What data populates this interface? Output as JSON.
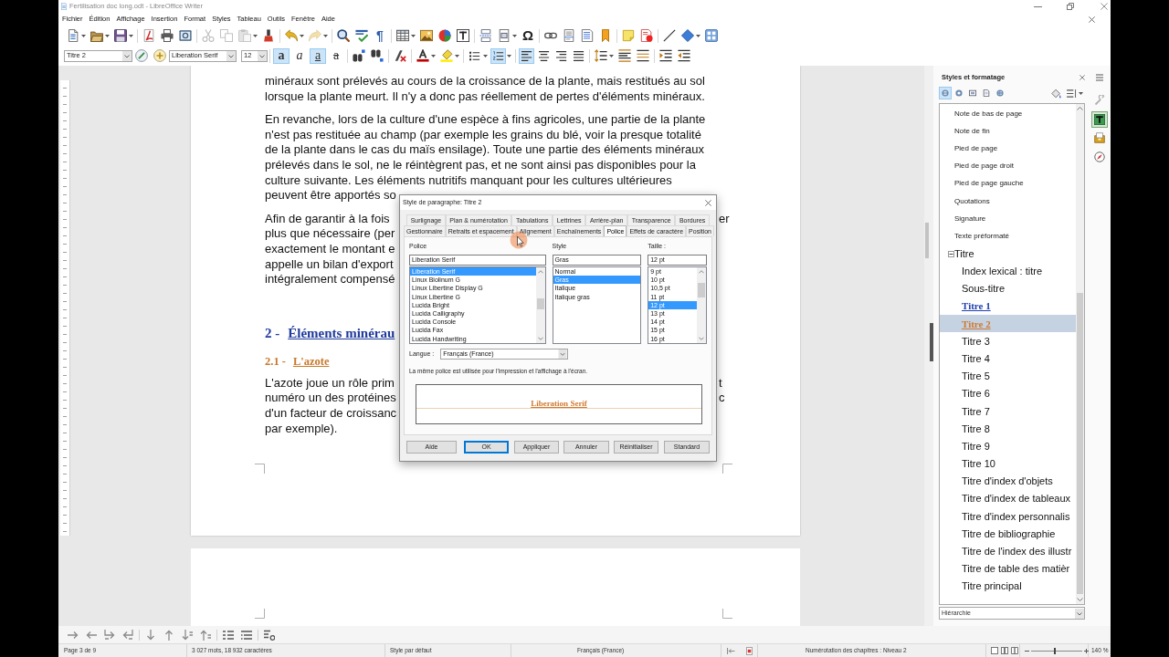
{
  "window": {
    "title": "Fertilisation doc long.odt - LibreOffice Writer"
  },
  "menu": [
    "Fichier",
    "Édition",
    "Affichage",
    "Insertion",
    "Format",
    "Styles",
    "Tableau",
    "Outils",
    "Fenêtre",
    "Aide"
  ],
  "standard_toolbar": {
    "cut_disabled": true,
    "copy_disabled": true,
    "paste_disabled": true,
    "redo_disabled": true,
    "formatting_marks_glyph": "¶",
    "special_character_glyph": "Ω"
  },
  "formatting_toolbar": {
    "paragraph_style": "Titre 2",
    "font_name": "Liberation Serif",
    "font_size": "12",
    "character_toggles": [
      {
        "kind": "bold",
        "glyph": "a",
        "active": true
      },
      {
        "kind": "italic",
        "glyph": "a",
        "active": false
      },
      {
        "kind": "underline",
        "glyph": "a",
        "active": true
      },
      {
        "kind": "strikethrough",
        "glyph": "a",
        "active": false
      }
    ],
    "bullets_active": false,
    "numbering_active": true,
    "alignments": [
      {
        "kind": "left",
        "selected": true
      },
      {
        "kind": "center",
        "selected": false
      },
      {
        "kind": "right",
        "selected": false
      },
      {
        "kind": "justify",
        "selected": false
      }
    ]
  },
  "document": {
    "blocks": [
      {
        "kind": "paragraph",
        "lines": [
          "minéraux sont prélevés au cours de la croissance de la plante, mais restitués au sol",
          "lorsque la plante meurt. Il n'y a donc pas réellement de pertes d'éléments minéraux."
        ]
      },
      {
        "kind": "paragraph",
        "lines": [
          "En revanche, lors de la culture d'une espèce à fins agricoles, une partie de la plante",
          "n'est pas restituée au champ (par exemple les grains du blé, voir la presque totalité",
          "de la plante dans le cas du maïs ensilage). Toute une partie des éléments minéraux",
          "prélevés dans le sol, ne le réintègrent pas, et ne sont ainsi pas disponibles pour la",
          "culture suivante. Les éléments nutritifs manquant pour les cultures ultérieures"
        ],
        "covered_lines": [
          "peuvent être apportés so"
        ]
      },
      {
        "kind": "paragraph",
        "lines": [
          "Afin de garantir à la fois",
          "plus que nécessaire (per",
          "exactement le montant e",
          "appelle un bilan d'export",
          "intégralement compensé"
        ],
        "right_fragments": [
          "er"
        ]
      },
      {
        "kind": "heading-1",
        "number": "2 -",
        "text": "Éléments minérau"
      },
      {
        "kind": "heading-2",
        "number": "2.1 -",
        "text": "L'azote"
      },
      {
        "kind": "paragraph",
        "lines": [
          "L'azote joue un rôle prim",
          "numéro un des protéines",
          "d'un facteur de croissanc",
          "par exemple)."
        ],
        "right_fragments": [
          "t",
          "c"
        ]
      }
    ]
  },
  "dialog": {
    "title": "Style de paragraphe: Titre 2",
    "tab_rows": [
      [
        {
          "label": "Surlignage",
          "selected": false
        },
        {
          "label": "Plan & numérotation",
          "selected": false
        },
        {
          "label": "Tabulations",
          "selected": false
        },
        {
          "label": "Lettrines",
          "selected": false
        },
        {
          "label": "Arrière-plan",
          "selected": false
        },
        {
          "label": "Transparence",
          "selected": false
        },
        {
          "label": "Bordures",
          "selected": false
        }
      ],
      [
        {
          "label": "Gestionnaire",
          "selected": false
        },
        {
          "label": "Retraits et espacement",
          "selected": false
        },
        {
          "label": "Alignement",
          "selected": false
        },
        {
          "label": "Enchaînements",
          "selected": false
        },
        {
          "label": "Police",
          "selected": true
        },
        {
          "label": "Effets de caractère",
          "selected": false
        },
        {
          "label": "Position",
          "selected": false
        }
      ]
    ],
    "font_family": {
      "label": "Police",
      "value": "Liberation Serif",
      "options": [
        {
          "label": "Liberation Serif",
          "selected": true
        },
        {
          "label": "Linux Biolinum G",
          "selected": false
        },
        {
          "label": "Linux Libertine Display G",
          "selected": false
        },
        {
          "label": "Linux Libertine G",
          "selected": false
        },
        {
          "label": "Lucida Bright",
          "selected": false
        },
        {
          "label": "Lucida Calligraphy",
          "selected": false
        },
        {
          "label": "Lucida Console",
          "selected": false
        },
        {
          "label": "Lucida Fax",
          "selected": false
        },
        {
          "label": "Lucida Handwriting",
          "selected": false
        }
      ]
    },
    "font_style": {
      "label": "Style",
      "value": "Gras",
      "options": [
        {
          "label": "Normal",
          "selected": false
        },
        {
          "label": "Gras",
          "selected": true
        },
        {
          "label": "Italique",
          "selected": false
        },
        {
          "label": "Italique gras",
          "selected": false
        }
      ]
    },
    "font_size": {
      "label": "Taille :",
      "value": "12 pt",
      "options": [
        {
          "label": "9 pt",
          "selected": false
        },
        {
          "label": "10 pt",
          "selected": false
        },
        {
          "label": "10,5 pt",
          "selected": false
        },
        {
          "label": "11 pt",
          "selected": false
        },
        {
          "label": "12 pt",
          "selected": true
        },
        {
          "label": "13 pt",
          "selected": false
        },
        {
          "label": "14 pt",
          "selected": false
        },
        {
          "label": "15 pt",
          "selected": false
        },
        {
          "label": "16 pt",
          "selected": false
        }
      ]
    },
    "language": {
      "label": "Langue :",
      "value": "Français (France)"
    },
    "note": "La même police est utilisée pour l'impression et l'affichage à l'écran.",
    "preview": "Liberation Serif",
    "buttons": [
      {
        "label": "Aide",
        "default": false
      },
      {
        "label": "OK",
        "default": true
      },
      {
        "label": "Appliquer",
        "default": false
      },
      {
        "label": "Annuler",
        "default": false
      },
      {
        "label": "Réinitialiser",
        "default": false
      },
      {
        "label": "Standard",
        "default": false
      }
    ]
  },
  "sidebar": {
    "title": "Styles et formatage",
    "style_families": [
      {
        "selected": true
      },
      {
        "selected": false
      },
      {
        "selected": false
      },
      {
        "selected": false
      },
      {
        "selected": false
      }
    ],
    "styles": [
      {
        "label": "Note de bas de page",
        "kind": "small",
        "selected": false
      },
      {
        "label": "Note de fin",
        "kind": "small",
        "selected": false
      },
      {
        "label": "Pied de page",
        "kind": "small",
        "selected": false
      },
      {
        "label": "Pied de page droit",
        "kind": "small",
        "selected": false
      },
      {
        "label": "Pied de page gauche",
        "kind": "small",
        "selected": false
      },
      {
        "label": "Quotations",
        "kind": "small",
        "selected": false
      },
      {
        "label": "Signature",
        "kind": "small",
        "selected": false
      },
      {
        "label": "Texte préformaté",
        "kind": "small",
        "selected": false
      },
      {
        "label": "Titre",
        "kind": "large",
        "selected": false,
        "expanded": true,
        "children": [
          {
            "label": "Index lexical : titre",
            "kind": "large",
            "selected": false
          },
          {
            "label": "Sous-titre",
            "kind": "large",
            "selected": false
          },
          {
            "label": "Titre 1",
            "kind": "heading-1",
            "selected": false
          },
          {
            "label": "Titre 2",
            "kind": "heading-2",
            "selected": true
          },
          {
            "label": "Titre 3",
            "kind": "large",
            "selected": false
          },
          {
            "label": "Titre 4",
            "kind": "large",
            "selected": false
          },
          {
            "label": "Titre 5",
            "kind": "large",
            "selected": false
          },
          {
            "label": "Titre 6",
            "kind": "large",
            "selected": false
          },
          {
            "label": "Titre 7",
            "kind": "large",
            "selected": false
          },
          {
            "label": "Titre 8",
            "kind": "large",
            "selected": false
          },
          {
            "label": "Titre 9",
            "kind": "large",
            "selected": false
          },
          {
            "label": "Titre 10",
            "kind": "large",
            "selected": false
          },
          {
            "label": "Titre d'index d'objets",
            "kind": "large",
            "selected": false
          },
          {
            "label": "Titre d'index de tableaux",
            "kind": "large",
            "selected": false
          },
          {
            "label": "Titre d'index personnalis",
            "kind": "large",
            "selected": false
          },
          {
            "label": "Titre de bibliographie",
            "kind": "large",
            "selected": false
          },
          {
            "label": "Titre de l'index des illustr",
            "kind": "large",
            "selected": false
          },
          {
            "label": "Titre de table des matièr",
            "kind": "large",
            "selected": false
          },
          {
            "label": "Titre principal",
            "kind": "large",
            "selected": false
          }
        ]
      }
    ],
    "filter": "Hiérarchie",
    "deck_tabs": [
      {
        "selected": false
      },
      {
        "selected": true
      },
      {
        "selected": false
      },
      {
        "selected": false
      }
    ]
  },
  "status_bar": {
    "page": "Page 3 de 9",
    "word_count": "3 027 mots, 18 932 caractères",
    "page_style": "Style par défaut",
    "language": "Français (France)",
    "outline_level": "Numérotation des chapitres : Niveau 2",
    "zoom_slider": {
      "level": 0.45
    },
    "zoom": "140 %"
  }
}
